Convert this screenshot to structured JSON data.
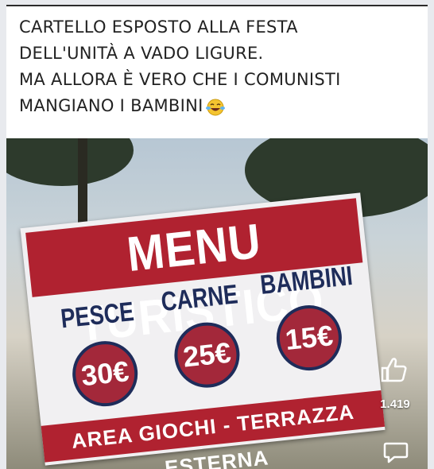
{
  "post": {
    "caption_lines": [
      "CARTELLO ESPOSTO ALLA FESTA",
      "DELL'UNITÀ A VADO LIGURE.",
      "MA ALLORA È  VERO CHE I COMUNISTI",
      "MANGIANO I BAMBINI"
    ],
    "emoji": "laughing-crying-emoji"
  },
  "sign": {
    "title": "MENU TURISTICO",
    "categories": [
      {
        "label": "PESCE",
        "price": "30€"
      },
      {
        "label": "CARNE",
        "price": "25€"
      },
      {
        "label": "BAMBINI",
        "price": "15€"
      }
    ],
    "footer": "AREA GIOCHI - TERRAZZA ESTERNA"
  },
  "reactions": {
    "like_icon": "thumbs-up-icon",
    "like_count": "1.419",
    "comment_icon": "comment-icon"
  }
}
